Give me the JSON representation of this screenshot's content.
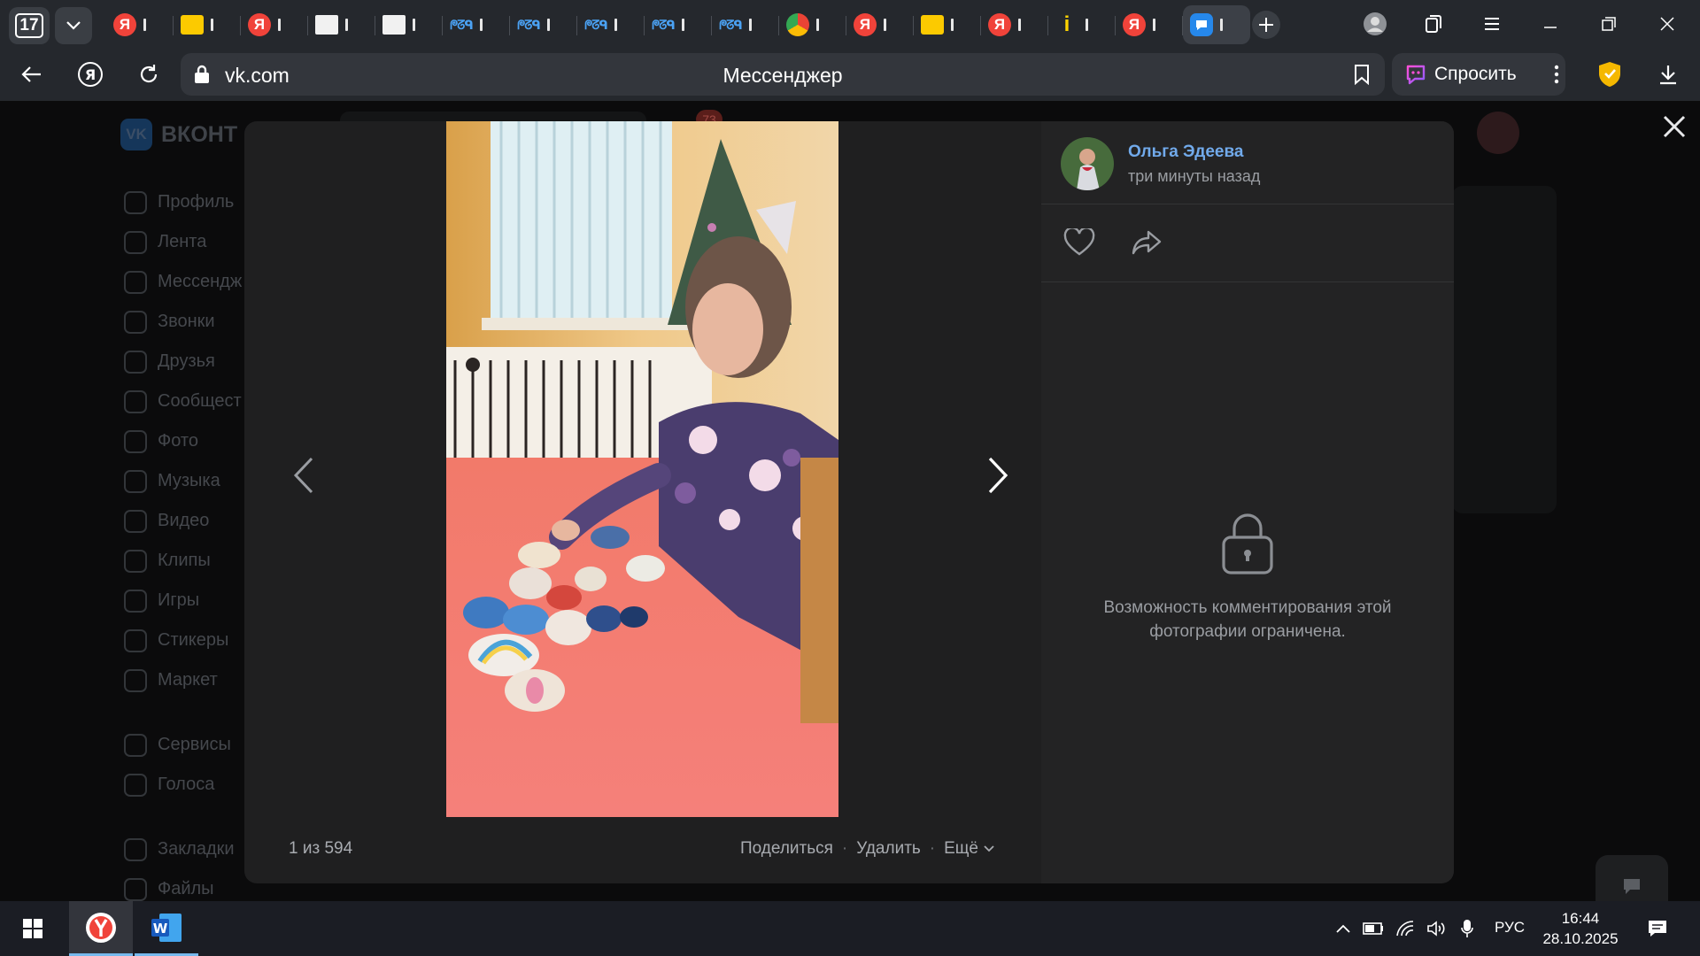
{
  "browser": {
    "tab_count": "17",
    "tabs": [
      {
        "kind": "ya",
        "glyph": "Я",
        "name": "tab-yandex-1"
      },
      {
        "kind": "img",
        "glyph": "",
        "name": "tab-images-1"
      },
      {
        "kind": "ya",
        "glyph": "Я",
        "name": "tab-yandex-2"
      },
      {
        "kind": "card",
        "glyph": "",
        "name": "tab-card-1"
      },
      {
        "kind": "card",
        "glyph": "",
        "name": "tab-card-2"
      },
      {
        "kind": "spk",
        "glyph": "ᖘᘔᑫ",
        "name": "tab-site-1"
      },
      {
        "kind": "spk",
        "glyph": "ᖘᘔᑫ",
        "name": "tab-site-2"
      },
      {
        "kind": "spk",
        "glyph": "ᖘᘔᑫ",
        "name": "tab-site-3"
      },
      {
        "kind": "spk",
        "glyph": "ᖘᘔᑫ",
        "name": "tab-site-4"
      },
      {
        "kind": "spk",
        "glyph": "ᖘᘔᑫ",
        "name": "tab-site-5"
      },
      {
        "kind": "chr",
        "glyph": "",
        "name": "tab-chrome-like"
      },
      {
        "kind": "ya",
        "glyph": "Я",
        "name": "tab-yandex-3"
      },
      {
        "kind": "img",
        "glyph": "",
        "name": "tab-images-2"
      },
      {
        "kind": "ya",
        "glyph": "Я",
        "name": "tab-yandex-4"
      },
      {
        "kind": "i",
        "glyph": "i",
        "name": "tab-info"
      },
      {
        "kind": "ya",
        "glyph": "Я",
        "name": "tab-yandex-5"
      },
      {
        "kind": "msg",
        "glyph": "",
        "name": "tab-vk-messenger",
        "active": true
      }
    ],
    "url_host": "vk.com",
    "page_title": "Мессенджер",
    "ask_label": "Спросить"
  },
  "vk": {
    "logo_text": "ВКОНТ",
    "notif_count": "73",
    "sidebar": [
      "Профиль",
      "Лента",
      "Мессендж",
      "Звонки",
      "Друзья",
      "Сообщест",
      "Фото",
      "Музыка",
      "Видео",
      "Клипы",
      "Игры",
      "Стикеры",
      "Маркет"
    ],
    "sidebar2": [
      "Сервисы",
      "Голоса"
    ],
    "sidebar3": [
      "Закладки",
      "Файлы"
    ]
  },
  "viewer": {
    "counter": "1 из 594",
    "share": "Поделиться",
    "delete": "Удалить",
    "more": "Ещё",
    "author_name": "Ольга Эдеева",
    "posted": "три минуты назад",
    "comments_locked": "Возможность комментирования этой фотографии ограничена."
  },
  "taskbar": {
    "lang": "РУС",
    "time": "16:44",
    "date": "28.10.2025"
  },
  "colors": {
    "accent_link": "#71aaeb",
    "vk_blue": "#2688eb",
    "yandex_red": "#f0433a"
  }
}
